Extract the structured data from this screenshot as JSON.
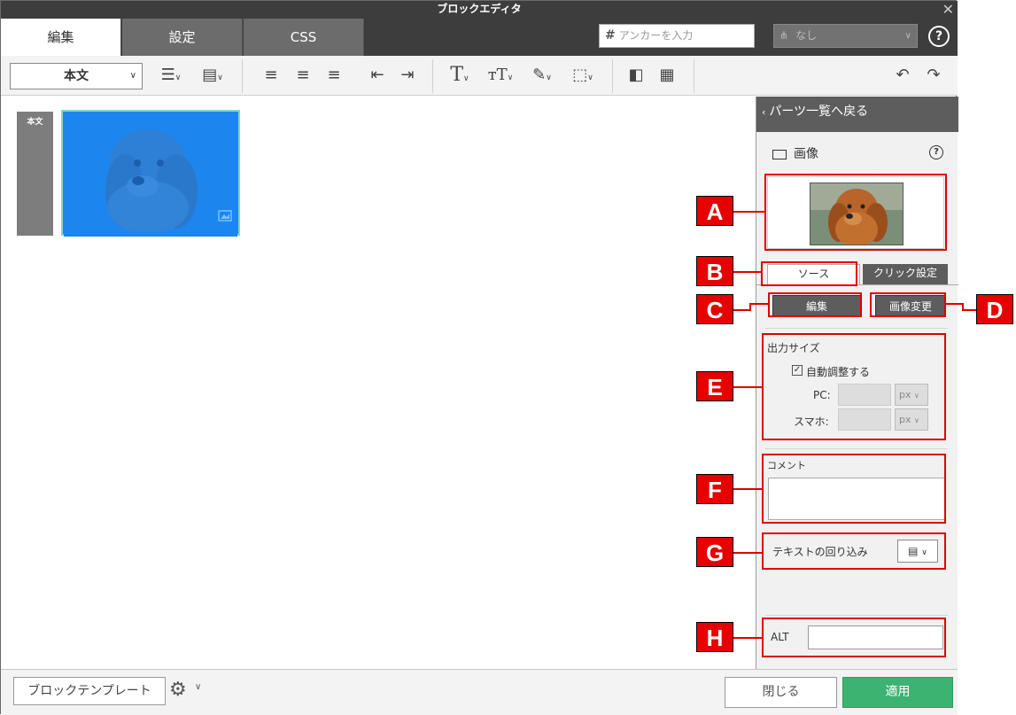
{
  "window": {
    "title": "ブロックエディタ",
    "close_glyph": "✕"
  },
  "tabs": [
    {
      "label": "編集"
    },
    {
      "label": "設定"
    },
    {
      "label": "CSS"
    }
  ],
  "anchor_input": {
    "placeholder": "アンカーを入力",
    "hash": "#"
  },
  "anchor_select": {
    "value": "なし",
    "icon": "share-icon"
  },
  "help_glyph": "?",
  "toolbar": {
    "paragraph_style": "本文",
    "icons": [
      "list-icon",
      "block-format-icon",
      "align-left-icon",
      "align-center-icon",
      "align-right-icon",
      "outdent-icon",
      "indent-icon",
      "text-style-icon",
      "font-size-icon",
      "eyedropper-icon",
      "border-icon",
      "column-icon",
      "delete-block-icon",
      "undo-icon",
      "redo-icon"
    ]
  },
  "canvas": {
    "block_tag": "本文"
  },
  "panel": {
    "back_label": "パーツ一覧へ戻る",
    "title": "画像",
    "tab_source": "ソース",
    "tab_click": "クリック設定",
    "edit_button": "編集",
    "change_image_button": "画像変更",
    "output_size_label": "出力サイズ",
    "auto_adjust_label": "自動調整する",
    "auto_adjust_checked": true,
    "pc_label": "PC:",
    "sp_label": "スマホ:",
    "unit": "px",
    "comment_label": "コメント",
    "wrap_label": "テキストの回り込み",
    "alt_label": "ALT"
  },
  "footer": {
    "template_button": "ブロックテンプレート",
    "close_button": "閉じる",
    "apply_button": "適用"
  },
  "callouts": [
    "A",
    "B",
    "C",
    "D",
    "E",
    "F",
    "G",
    "H"
  ],
  "colors": {
    "annotation": "#e00000",
    "apply": "#3cb371",
    "selection": "#1c86ee"
  }
}
